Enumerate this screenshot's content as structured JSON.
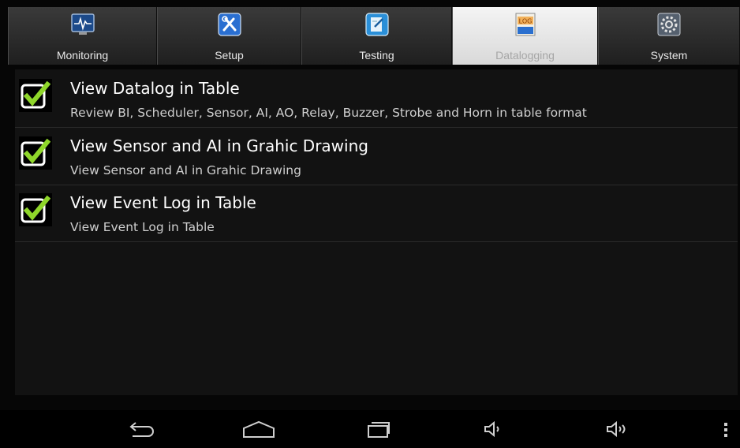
{
  "tabs": [
    {
      "label": "Monitoring",
      "icon": "monitoring-icon",
      "active": false
    },
    {
      "label": "Setup",
      "icon": "setup-tools-icon",
      "active": false
    },
    {
      "label": "Testing",
      "icon": "testing-clipboard-icon",
      "active": false
    },
    {
      "label": "Datalogging",
      "icon": "datalog-icon",
      "active": true,
      "icon_text": "LOG"
    },
    {
      "label": "System",
      "icon": "system-gear-icon",
      "active": false
    }
  ],
  "items": [
    {
      "title": "View Datalog in Table",
      "description": "Review BI, Scheduler, Sensor, AI, AO, Relay, Buzzer, Strobe and Horn in table format",
      "checked": true
    },
    {
      "title": "View Sensor and AI in Grahic Drawing",
      "description": "View Sensor and AI in Grahic Drawing",
      "checked": true
    },
    {
      "title": "View Event Log in Table",
      "description": "View Event Log in Table",
      "checked": true
    }
  ],
  "navbar": [
    "back-icon",
    "home-icon",
    "recent-apps-icon",
    "volume-down-icon",
    "volume-up-icon",
    "overflow-menu-icon"
  ],
  "colors": {
    "check_green": "#8fd62a",
    "active_tab": "#e9e9e9",
    "content_bg": "#121212"
  }
}
